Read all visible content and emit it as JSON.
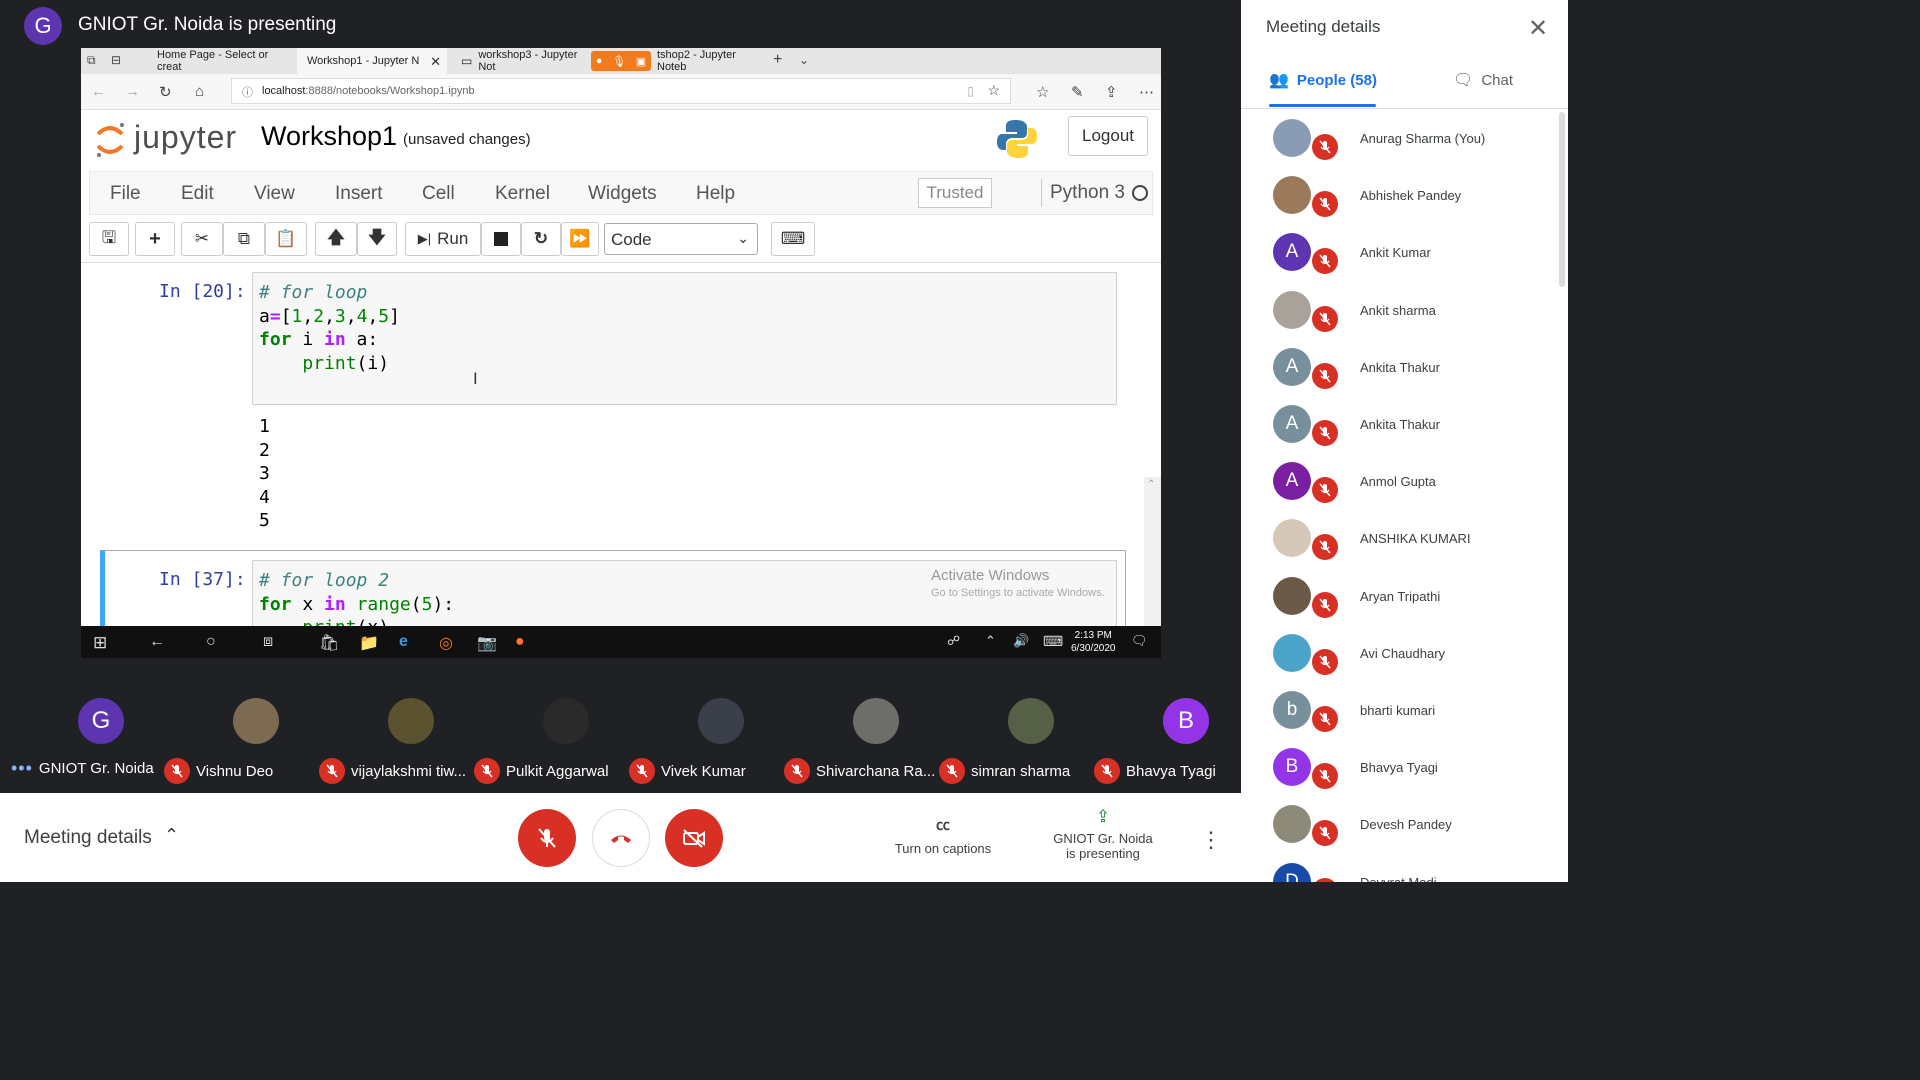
{
  "presenter": {
    "initial": "G",
    "title": "GNIOT Gr. Noida is presenting"
  },
  "browser": {
    "tabs": [
      {
        "label": "Home Page - Select or creat"
      },
      {
        "label": "Workshop1 - Jupyter N"
      },
      {
        "label": "workshop3 - Jupyter Not"
      },
      {
        "label": "tshop2 - Jupyter Noteb"
      }
    ],
    "url_host": "localhost",
    "url_path": ":8888/notebooks/Workshop1.ipynb"
  },
  "jupyter": {
    "logo_text": "jupyter",
    "notebook_name": "Workshop1",
    "status": "(unsaved changes)",
    "logout_label": "Logout",
    "menu": [
      "File",
      "Edit",
      "View",
      "Insert",
      "Cell",
      "Kernel",
      "Widgets",
      "Help"
    ],
    "trusted_label": "Trusted",
    "kernel_name": "Python 3",
    "run_label": "Run",
    "cell_type": "Code",
    "cells": [
      {
        "prompt": "In [20]:",
        "output": "1\n2\n3\n4\n5"
      },
      {
        "prompt": "In [37]:"
      }
    ],
    "watermark_title": "Activate Windows",
    "watermark_sub": "Go to Settings to activate Windows."
  },
  "taskbar": {
    "time": "2:13 PM",
    "date": "6/30/2020"
  },
  "participants_tiles": [
    {
      "initial": "G",
      "name": "GNIOT Gr. Noida",
      "color": "#5e35b1"
    },
    {
      "initial": "",
      "name": "Vishnu Deo",
      "color": "#7d6a52"
    },
    {
      "initial": "",
      "name": "vijaylakshmi tiw...",
      "color": "#5b5230"
    },
    {
      "initial": "",
      "name": "Pulkit Aggarwal",
      "color": "#2a2a2a"
    },
    {
      "initial": "",
      "name": "Vivek Kumar",
      "color": "#3b3f4a"
    },
    {
      "initial": "",
      "name": "Shivarchana Ra...",
      "color": "#6d6e6a"
    },
    {
      "initial": "",
      "name": "simran sharma",
      "color": "#566046"
    },
    {
      "initial": "B",
      "name": "Bhavya Tyagi",
      "color": "#9334e6"
    }
  ],
  "bottom": {
    "meeting_details": "Meeting details",
    "captions": "Turn on captions",
    "presenting_line1": "GNIOT Gr. Noida",
    "presenting_line2": "is presenting"
  },
  "side_panel": {
    "title": "Meeting details",
    "people_tab": "People (58)",
    "chat_tab": "Chat",
    "people": [
      {
        "name": "Anurag Sharma (You)",
        "initial": "",
        "color": "#8a9bb5"
      },
      {
        "name": "Abhishek Pandey",
        "initial": "",
        "color": "#9a7a5a"
      },
      {
        "name": "Ankit Kumar",
        "initial": "A",
        "color": "#5e35b1"
      },
      {
        "name": "Ankit sharma",
        "initial": "",
        "color": "#a9a29a"
      },
      {
        "name": "Ankita Thakur",
        "initial": "A",
        "color": "#78909c"
      },
      {
        "name": "Ankita Thakur",
        "initial": "A",
        "color": "#78909c"
      },
      {
        "name": "Anmol Gupta",
        "initial": "A",
        "color": "#7b1fa2"
      },
      {
        "name": "ANSHIKA KUMARI",
        "initial": "",
        "color": "#d6c8b8"
      },
      {
        "name": "Aryan Tripathi",
        "initial": "",
        "color": "#6b5a4a"
      },
      {
        "name": "Avi Chaudhary",
        "initial": "",
        "color": "#4aa3c9"
      },
      {
        "name": "bharti kumari",
        "initial": "b",
        "color": "#78909c"
      },
      {
        "name": "Bhavya Tyagi",
        "initial": "B",
        "color": "#9334e6"
      },
      {
        "name": "Devesh Pandey",
        "initial": "",
        "color": "#8e8a7a"
      },
      {
        "name": "Devyrat Modi",
        "initial": "D",
        "color": "#1a4aa8"
      }
    ]
  }
}
